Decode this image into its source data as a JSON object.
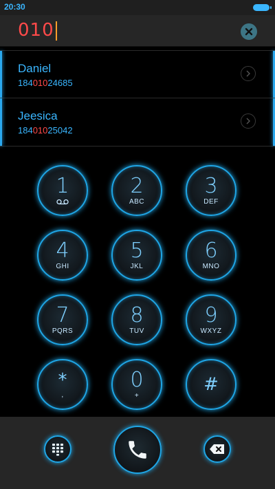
{
  "status_bar": {
    "time": "20:30"
  },
  "dialer": {
    "input_value": "010"
  },
  "results": [
    {
      "name": "Daniel",
      "number_pre": "184",
      "number_match": "010",
      "number_post": "24685"
    },
    {
      "name": "Jeesica",
      "number_pre": "184",
      "number_match": "010",
      "number_post": "25042"
    }
  ],
  "keypad": [
    {
      "digit": "1",
      "letters": "",
      "icon": "voicemail-icon"
    },
    {
      "digit": "2",
      "letters": "ABC"
    },
    {
      "digit": "3",
      "letters": "DEF"
    },
    {
      "digit": "4",
      "letters": "GHI"
    },
    {
      "digit": "5",
      "letters": "JKL"
    },
    {
      "digit": "6",
      "letters": "MNO"
    },
    {
      "digit": "7",
      "letters": "PQRS"
    },
    {
      "digit": "8",
      "letters": "TUV"
    },
    {
      "digit": "9",
      "letters": "WXYZ"
    },
    {
      "digit": "*",
      "letters": ","
    },
    {
      "digit": "0",
      "letters": "+"
    },
    {
      "digit": "#",
      "letters": ""
    }
  ],
  "actions": {
    "keypad_toggle": "dialpad-icon",
    "call": "phone-icon",
    "delete": "backspace-icon"
  },
  "colors": {
    "accent_blue": "#1fa6e6",
    "match_red": "#ff4a4a",
    "cursor_orange": "#ff9f2a"
  }
}
